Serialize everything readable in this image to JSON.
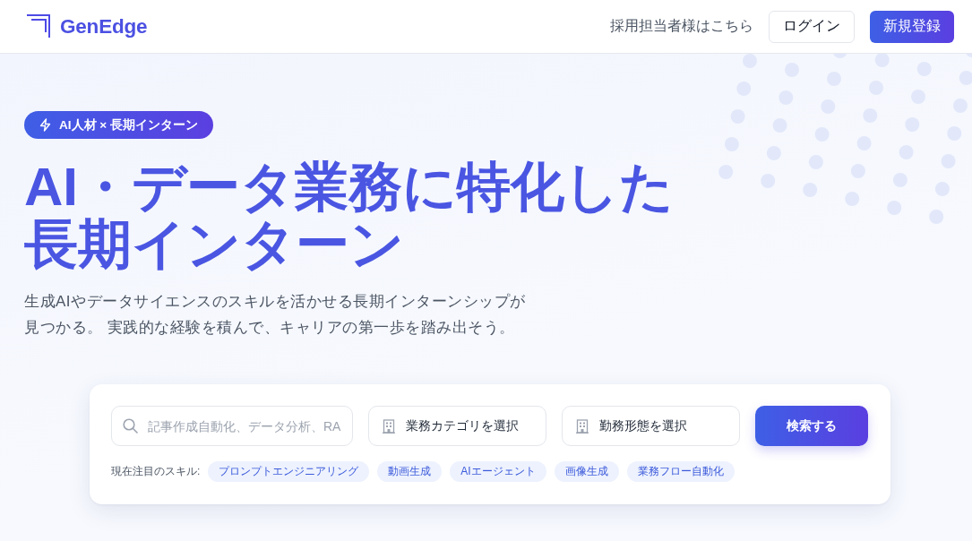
{
  "header": {
    "logo": "GenEdge",
    "links": [
      {
        "label": "採用担当者様はこちら"
      }
    ],
    "buttons": [
      {
        "label": "ログイン",
        "kind": "outline"
      },
      {
        "label": "新規登録",
        "kind": "primary"
      }
    ]
  },
  "hero": {
    "badge": "AI人材 × 長期インターン",
    "title": "AI・データ業務に特化した長期インターン",
    "subtitle": "生成AIやデータサイエンスのスキルを活かせる長期インターンシップが見つかる。 実践的な経験を積んで、キャリアの第一歩を踏み出そう。"
  },
  "search": {
    "keyword": {
      "placeholder": "記事作成自動化、データ分析、RA"
    },
    "selects": [
      {
        "label": "業務カテゴリを選択"
      },
      {
        "label": "勤務形態を選択"
      }
    ],
    "button": "検索する",
    "trending": {
      "label": "現在注目のスキル:",
      "tags": [
        "プロンプトエンジニアリング",
        "動画生成",
        "AIエージェント",
        "画像生成",
        "業務フロー自動化"
      ]
    }
  }
}
